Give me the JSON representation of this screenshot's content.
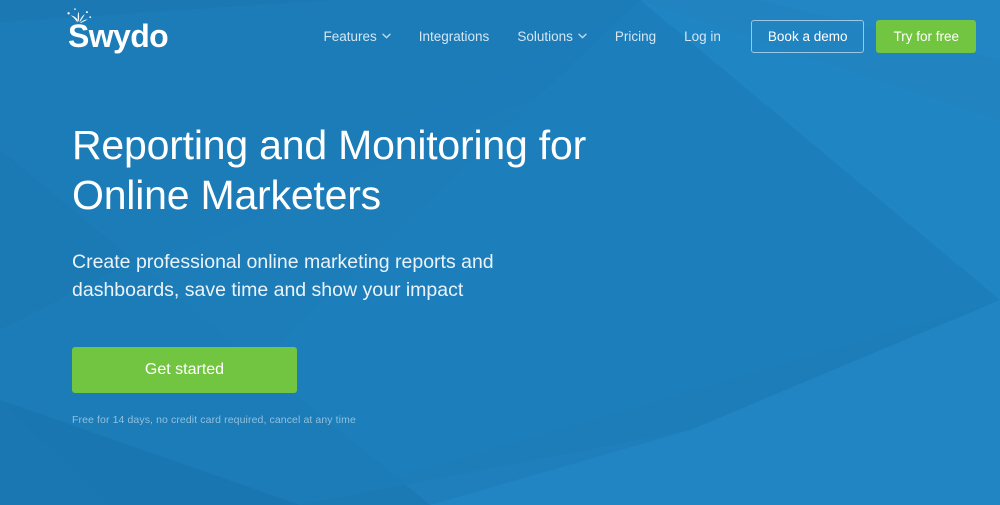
{
  "brand": {
    "name": "Swydo",
    "logo_icon": "sparkle-splash-icon",
    "accent_green": "#72c540",
    "background_blue": "#1e7fbc"
  },
  "header": {
    "nav": [
      {
        "label": "Features",
        "has_dropdown": true,
        "icon": "chevron-down-icon"
      },
      {
        "label": "Integrations",
        "has_dropdown": false,
        "icon": ""
      },
      {
        "label": "Solutions",
        "has_dropdown": true,
        "icon": "chevron-down-icon"
      },
      {
        "label": "Pricing",
        "has_dropdown": false,
        "icon": ""
      },
      {
        "label": "Log in",
        "has_dropdown": false,
        "icon": ""
      }
    ],
    "demo_button": "Book a demo",
    "trial_button": "Try for free"
  },
  "hero": {
    "headline": "Reporting and Monitoring for Online Marketers",
    "subheadline": "Create professional online marketing reports and dashboards, save time and show your impact",
    "cta_label": "Get started",
    "fineprint": "Free for 14 days, no credit card required, cancel at any time"
  }
}
